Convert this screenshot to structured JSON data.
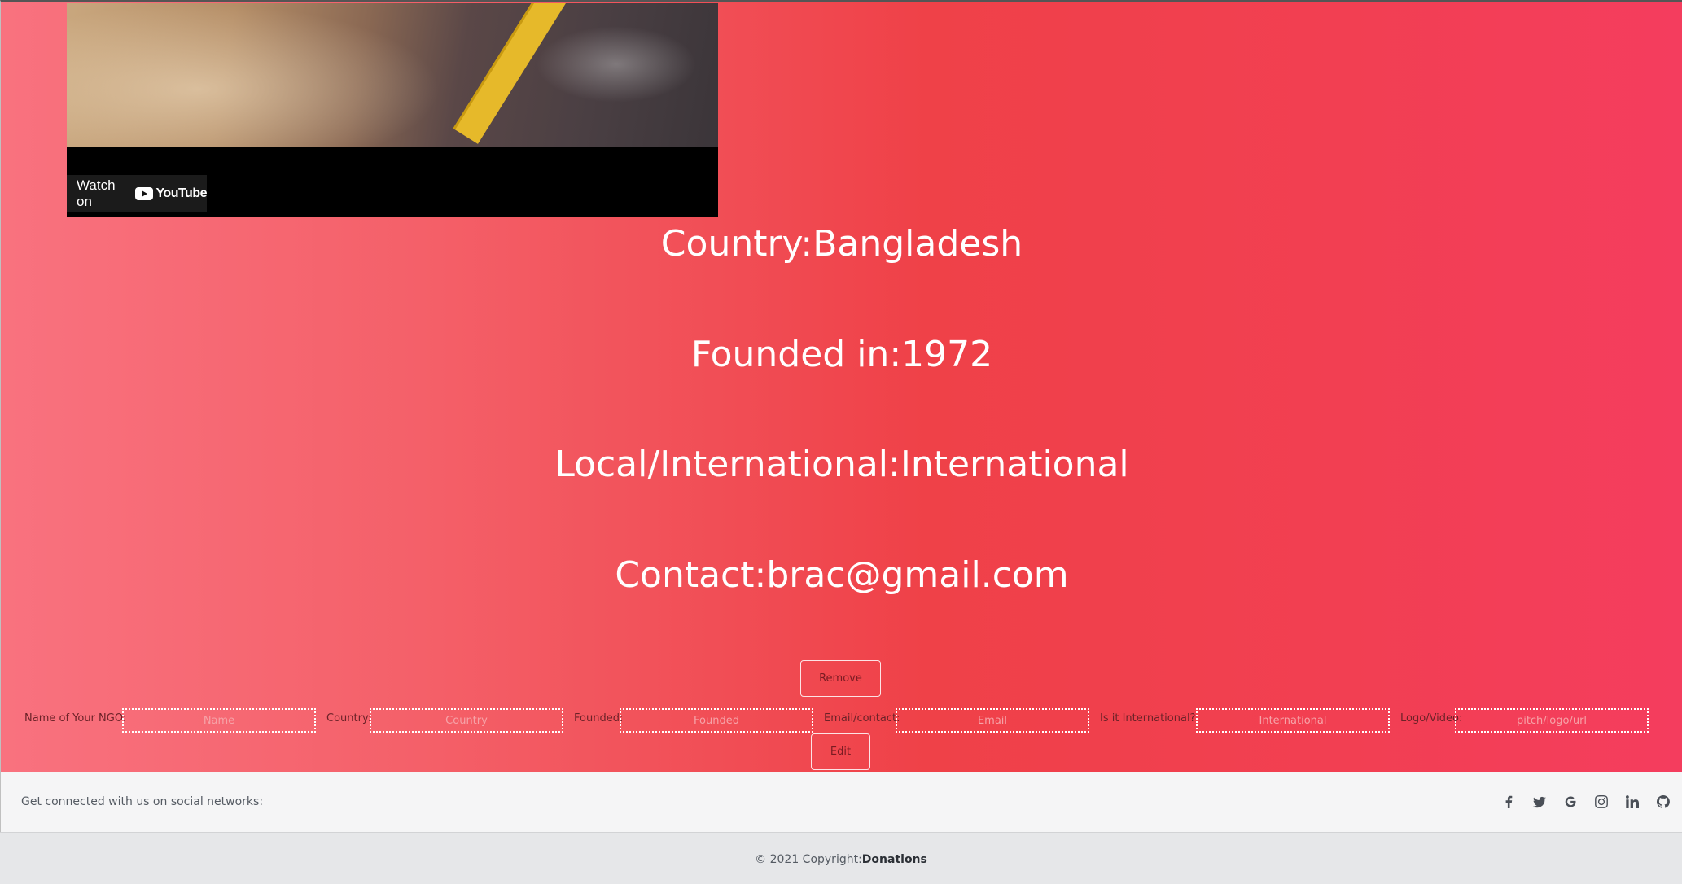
{
  "video": {
    "watch_label": "Watch on",
    "platform": "YouTube"
  },
  "ngo": {
    "country_line": "Country:Bangladesh",
    "founded_line": "Founded in:1972",
    "type_line": "Local/International:International",
    "contact_line": "Contact:brac@gmail.com"
  },
  "actions": {
    "remove_label": "Remove",
    "edit_label": "Edit"
  },
  "form": {
    "name_label": "Name of Your NGO:",
    "name_placeholder": "Name",
    "country_label": "Country:",
    "country_placeholder": "Country",
    "founded_label": "Founded:",
    "founded_placeholder": "Founded",
    "email_label": "Email/contact:",
    "email_placeholder": "Email",
    "international_label": "Is it International?",
    "international_placeholder": "International",
    "logo_label": "Logo/Video:",
    "logo_placeholder": "pitch/logo/url"
  },
  "social": {
    "connect_text": "Get connected with us on social networks:",
    "icons": [
      "facebook-icon",
      "twitter-icon",
      "google-icon",
      "instagram-icon",
      "linkedin-icon",
      "github-icon"
    ]
  },
  "footer": {
    "copyright_prefix": "© 2021 Copyright:",
    "brand": "Donations"
  },
  "colors": {
    "hero_gradient_start": "#f9727f",
    "hero_gradient_mid": "#ef4148",
    "hero_gradient_end": "#f43d5e",
    "social_bar_bg": "#f5f5f6",
    "footer_bg": "#e6e7e9"
  }
}
